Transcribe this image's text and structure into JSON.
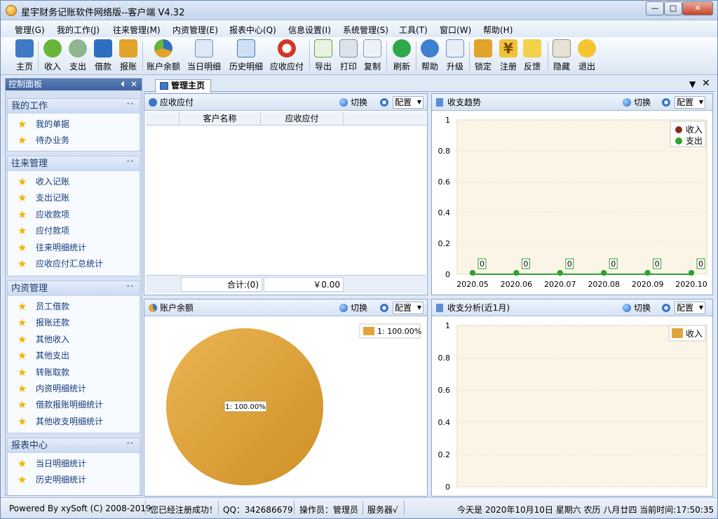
{
  "window": {
    "title": "星宇财务记账软件网络版--客户端 V4.32"
  },
  "menu": [
    "管理(G)",
    "我的工作(J)",
    "往来管理(M)",
    "内资管理(E)",
    "报表中心(Q)",
    "信息设置(I)",
    "系统管理(S)",
    "工具(T)",
    "窗口(W)",
    "帮助(H)"
  ],
  "toolbar": [
    {
      "label": "主页",
      "icon": "home-icon"
    },
    {
      "label": "收入",
      "icon": "income-icon"
    },
    {
      "label": "支出",
      "icon": "expense-icon"
    },
    {
      "label": "借款",
      "icon": "borrow-icon"
    },
    {
      "label": "报账",
      "icon": "reimburse-icon"
    },
    {
      "label": "账户余额",
      "icon": "account-balance-icon"
    },
    {
      "label": "当日明细",
      "icon": "daily-detail-icon"
    },
    {
      "label": "历史明细",
      "icon": "history-detail-icon"
    },
    {
      "label": "应收应付",
      "icon": "receivable-icon"
    },
    {
      "label": "导出",
      "icon": "export-icon"
    },
    {
      "label": "打印",
      "icon": "print-icon"
    },
    {
      "label": "复制",
      "icon": "copy-icon"
    },
    {
      "label": "刷新",
      "icon": "refresh-icon"
    },
    {
      "label": "帮助",
      "icon": "help-icon"
    },
    {
      "label": "升级",
      "icon": "upgrade-icon"
    },
    {
      "label": "锁定",
      "icon": "lock-icon"
    },
    {
      "label": "注册",
      "icon": "register-icon"
    },
    {
      "label": "反馈",
      "icon": "feedback-icon"
    },
    {
      "label": "隐藏",
      "icon": "hide-icon"
    },
    {
      "label": "退出",
      "icon": "exit-icon"
    }
  ],
  "control_panel": {
    "title": "控制面板",
    "groups": [
      {
        "title": "我的工作",
        "items": [
          "我的单据",
          "待办业务"
        ]
      },
      {
        "title": "往来管理",
        "items": [
          "收入记账",
          "支出记账",
          "应收款项",
          "应付款项",
          "往来明细统计",
          "应收应付汇总统计"
        ]
      },
      {
        "title": "内资管理",
        "items": [
          "员工借款",
          "报账还款",
          "其他收入",
          "其他支出",
          "转账取款",
          "内资明细统计",
          "借款报账明细统计",
          "其他收支明细统计"
        ]
      },
      {
        "title": "报表中心",
        "items": [
          "当日明细统计",
          "历史明细统计"
        ]
      }
    ]
  },
  "main_tab": {
    "label": "管理主页"
  },
  "panels": {
    "receivable": {
      "title": "应收应付",
      "switch": "切换",
      "config": "配置",
      "columns": [
        "客户名称",
        "应收应付"
      ],
      "total_label": "合计:(0)",
      "total_value": "￥0.00"
    },
    "trend": {
      "title": "收支趋势",
      "switch": "切换",
      "config": "配置"
    },
    "balance": {
      "title": "账户余额",
      "switch": "切换",
      "config": "配置"
    },
    "analysis": {
      "title": "收支分析(近1月)",
      "switch": "切换",
      "config": "配置"
    }
  },
  "chart_data": [
    {
      "type": "line",
      "x": [
        "2020.05",
        "2020.06",
        "2020.07",
        "2020.08",
        "2020.09",
        "2020.10"
      ],
      "ylim": [
        0,
        1
      ],
      "yticks": [
        "1",
        "0.8",
        "0.6",
        "0.4",
        "0.2",
        "0"
      ],
      "series": [
        {
          "name": "收入",
          "values": [
            0,
            0,
            0,
            0,
            0,
            0
          ],
          "color": "#8b2a1a"
        },
        {
          "name": "支出",
          "values": [
            0,
            0,
            0,
            0,
            0,
            0
          ],
          "color": "#2ea32e"
        }
      ],
      "data_labels": [
        "0",
        "0",
        "0",
        "0",
        "0",
        "0"
      ],
      "legend": "top-right"
    },
    {
      "type": "pie",
      "slices": [
        {
          "label": "1: 100.00%",
          "value": 100,
          "color": "#e0a63c"
        }
      ],
      "legend": "top-right",
      "legend_text": "1: 100.00%"
    },
    {
      "type": "bar",
      "ylim": [
        0,
        1
      ],
      "yticks": [
        "1",
        "0.8",
        "0.6",
        "0.4",
        "0.2",
        "0"
      ],
      "series": [
        {
          "name": "收入",
          "values": [],
          "color": "#e0a63c"
        }
      ],
      "legend": "top-right"
    }
  ],
  "status": {
    "powered": "Powered By xySoft (C) 2008-2019",
    "registered": "您已经注册成功！",
    "qq": "QQ：342686679",
    "operator": "操作员：管理员",
    "server": "服务器√",
    "today": "今天是 2020年10月10日 星期六 农历 八月廿四 当前时间:17:50:35"
  }
}
